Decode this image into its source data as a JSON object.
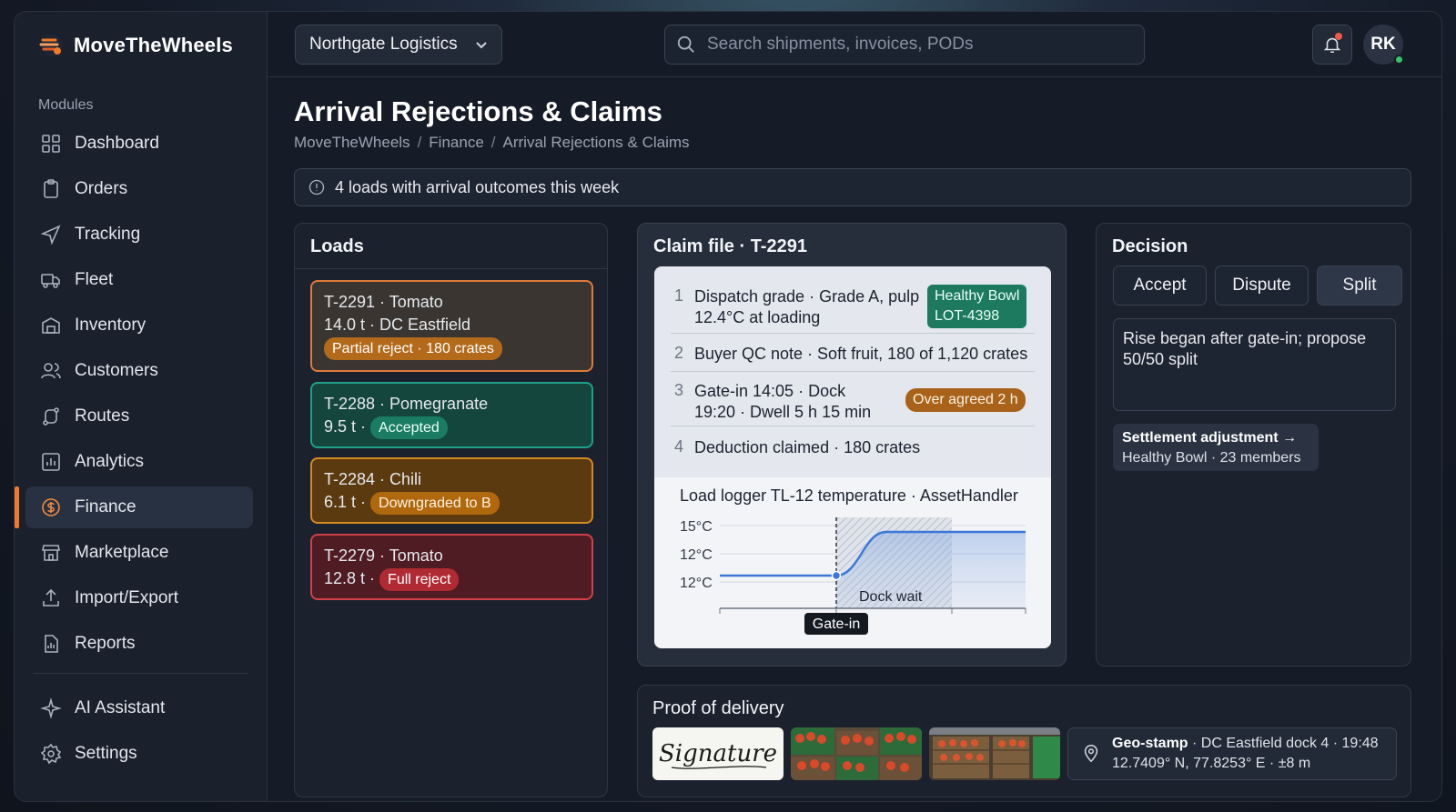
{
  "app": {
    "name": "MoveTheWheels"
  },
  "sidebar": {
    "section_label": "Modules",
    "items": [
      {
        "label": "Dashboard"
      },
      {
        "label": "Orders"
      },
      {
        "label": "Tracking"
      },
      {
        "label": "Fleet"
      },
      {
        "label": "Inventory"
      },
      {
        "label": "Customers"
      },
      {
        "label": "Routes"
      },
      {
        "label": "Analytics"
      },
      {
        "label": "Finance",
        "active": true
      },
      {
        "label": "Marketplace"
      },
      {
        "label": "Import/Export"
      },
      {
        "label": "Reports"
      }
    ],
    "bottom_items": [
      {
        "label": "AI Assistant"
      },
      {
        "label": "Settings"
      }
    ],
    "accent": "#ef7a2a"
  },
  "topbar": {
    "org": "Northgate Logistics",
    "search_placeholder": "Search shipments, invoices, PODs",
    "avatar_initials": "RK"
  },
  "page": {
    "title": "Arrival Rejections & Claims",
    "breadcrumb": [
      "MoveTheWheels",
      "Finance",
      "Arrival Rejections & Claims"
    ],
    "banner": "4 loads with arrival outcomes this week"
  },
  "loads": {
    "title": "Loads",
    "items": [
      {
        "line1": "T-2291 · Tomato",
        "line2": "14.0 t · DC Eastfield",
        "status": "Partial reject · 180 crates"
      },
      {
        "line1": "T-2288 · Pomegranate",
        "line2": "9.5 t ·",
        "status": "Accepted"
      },
      {
        "line1": "T-2284 · Chili",
        "line2": "6.1 t ·",
        "status": "Downgraded to B"
      },
      {
        "line1": "T-2279 · Tomato",
        "line2": "12.8 t ·",
        "status": "Full reject"
      }
    ]
  },
  "claim": {
    "title": "Claim file · T-2291",
    "rows": [
      {
        "num": "1",
        "line1": "Dispatch grade · Grade A, pulp",
        "line2": "12.4°C at loading",
        "tag1": "Healthy Bowl",
        "tag2": "LOT-4398"
      },
      {
        "num": "2",
        "line1": "Buyer QC note · Soft fruit, 180 of 1,120 crates"
      },
      {
        "num": "3",
        "line1": "Gate-in 14:05 · Dock",
        "line2": "19:20 · Dwell 5 h 15 min",
        "tag1": "Over agreed 2 h"
      },
      {
        "num": "4",
        "line1": "Deduction claimed · 180 crates"
      }
    ],
    "chart_title": "Load logger TL-12 temperature · AssetHandler"
  },
  "chart_data": {
    "type": "line",
    "title": "Load logger TL-12 temperature · AssetHandler",
    "y_tick_labels": [
      "15°C",
      "12°C",
      "12°C"
    ],
    "series": [
      {
        "values": [
          12.4,
          12.4,
          12.4,
          14.6,
          14.6,
          14.6
        ]
      }
    ],
    "annotations": [
      {
        "label": "Gate-in",
        "type": "marker"
      },
      {
        "label": "Dock wait",
        "type": "shaded-region"
      }
    ]
  },
  "decision": {
    "title": "Decision",
    "options": [
      "Accept",
      "Dispute",
      "Split"
    ],
    "selected": "Split",
    "note": "Rise began after gate-in; propose 50/50 split",
    "settlement_title": "Settlement adjustment →",
    "settlement_sub": "Healthy Bowl · 23 members"
  },
  "pod": {
    "title": "Proof of delivery",
    "signature_text": "Signature",
    "geo_title": "Geo-stamp",
    "geo_line1": "DC Eastfield dock 4 · 19:48",
    "geo_line2": "12.7409° N, 77.8253° E · ±8 m"
  }
}
